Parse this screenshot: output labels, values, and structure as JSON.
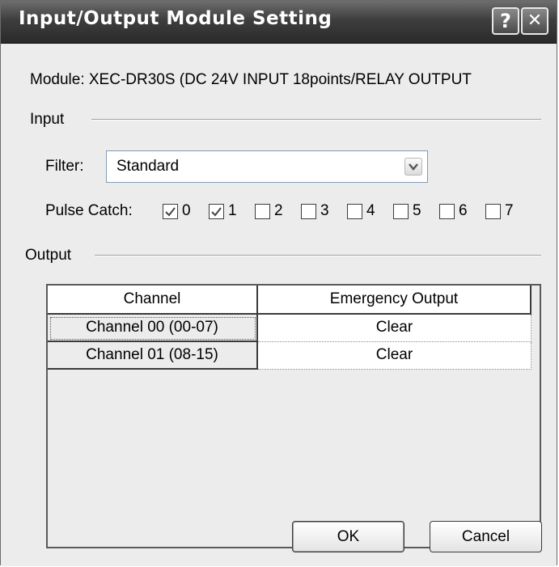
{
  "window": {
    "title": "Input/Output Module Setting",
    "help_glyph": "?",
    "close_glyph": "✕"
  },
  "module": {
    "text": "Module: XEC-DR30S (DC 24V INPUT 18points/RELAY OUTPUT"
  },
  "input": {
    "group_label": "Input",
    "filter": {
      "label": "Filter:",
      "value": "Standard"
    },
    "pulse_catch": {
      "label": "Pulse Catch:",
      "points": [
        {
          "label": "0",
          "checked": true
        },
        {
          "label": "1",
          "checked": true
        },
        {
          "label": "2",
          "checked": false
        },
        {
          "label": "3",
          "checked": false
        },
        {
          "label": "4",
          "checked": false
        },
        {
          "label": "5",
          "checked": false
        },
        {
          "label": "6",
          "checked": false
        },
        {
          "label": "7",
          "checked": false
        }
      ]
    }
  },
  "output": {
    "group_label": "Output",
    "columns": [
      "Channel",
      "Emergency Output"
    ],
    "rows": [
      {
        "channel": "Channel 00 (00-07)",
        "emergency": "Clear"
      },
      {
        "channel": "Channel 01 (08-15)",
        "emergency": "Clear"
      }
    ]
  },
  "buttons": {
    "ok": "OK",
    "cancel": "Cancel"
  },
  "colors": {
    "title_bar": "#3e3e3e",
    "dialog_bg": "#ececec"
  }
}
